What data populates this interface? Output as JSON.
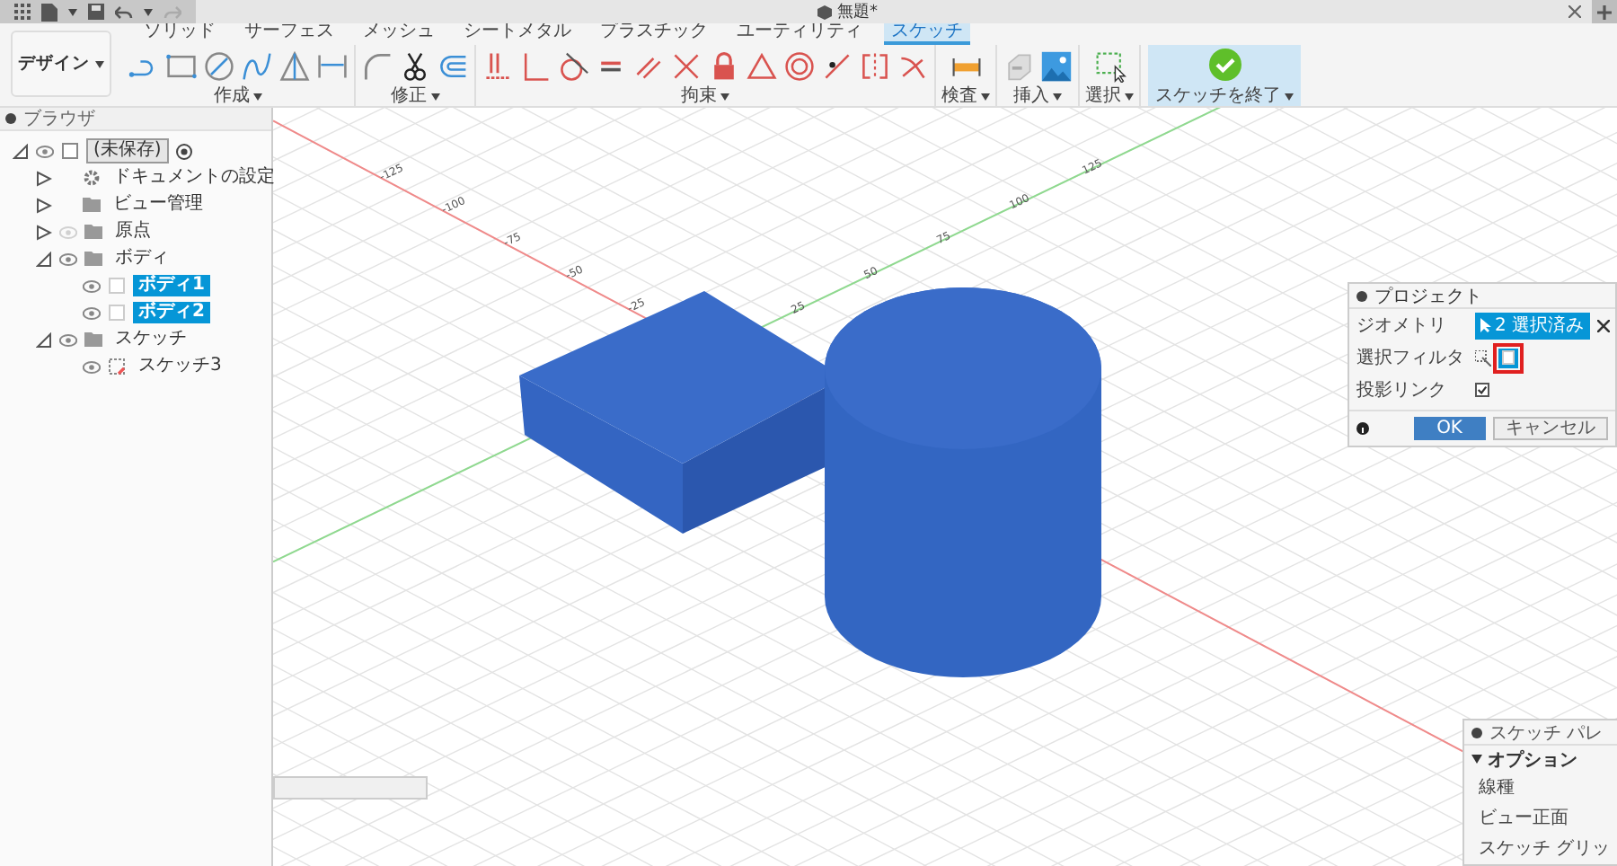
{
  "top_bar": {
    "title": "無題*",
    "redo": {
      "disabled": true
    }
  },
  "ribbon": {
    "workspace": "デザイン",
    "tabs": [
      {
        "label": "ソリッド",
        "selected": false
      },
      {
        "label": "サーフェス",
        "selected": false
      },
      {
        "label": "メッシュ",
        "selected": false
      },
      {
        "label": "シートメタル",
        "selected": false
      },
      {
        "label": "プラスチック",
        "selected": false
      },
      {
        "label": "ユーティリティ",
        "selected": false
      },
      {
        "label": "スケッチ",
        "selected": true
      }
    ],
    "groups": [
      {
        "label": "作成",
        "tools": [
          {
            "kind": "line"
          },
          {
            "kind": "rectangle"
          },
          {
            "kind": "circle"
          },
          {
            "kind": "spline"
          },
          {
            "kind": "mirror"
          },
          {
            "kind": "dimension"
          }
        ]
      },
      {
        "label": "修正",
        "tools": [
          {
            "kind": "fillet"
          },
          {
            "kind": "trim"
          },
          {
            "kind": "offset"
          }
        ]
      },
      {
        "label": "拘束",
        "tools": [
          {
            "kind": "fix"
          },
          {
            "kind": "perpendicular"
          },
          {
            "kind": "tangent"
          },
          {
            "kind": "equal"
          },
          {
            "kind": "parallel"
          },
          {
            "kind": "cross"
          },
          {
            "kind": "lock"
          },
          {
            "kind": "triangle"
          },
          {
            "kind": "concentric"
          },
          {
            "kind": "collinear"
          },
          {
            "kind": "symmetry"
          },
          {
            "kind": "curvature"
          }
        ]
      },
      {
        "label": "検査",
        "tools": [
          {
            "kind": "measure"
          }
        ]
      },
      {
        "label": "挿入",
        "tools": [
          {
            "kind": "insert"
          },
          {
            "kind": "image"
          }
        ]
      },
      {
        "label": "選択",
        "tools": [
          {
            "kind": "select"
          }
        ]
      }
    ],
    "finish": {
      "label": "スケッチを終了"
    }
  },
  "browser": {
    "title": "ブラウザ",
    "tree": [
      {
        "label": "(未保存)",
        "kind": "component",
        "expanded": true,
        "selected": false,
        "visible": true,
        "children": [
          {
            "label": "ドキュメントの設定",
            "kind": "settings",
            "expanded": false,
            "selected": false
          },
          {
            "label": "ビュー管理",
            "kind": "folder",
            "expanded": false,
            "selected": false
          },
          {
            "label": "原点",
            "kind": "folder",
            "expanded": false,
            "selected": false,
            "visible": false
          },
          {
            "label": "ボディ",
            "kind": "folder",
            "expanded": true,
            "selected": false,
            "visible": true,
            "children": [
              {
                "label": "ボディ1",
                "kind": "body",
                "selected": true,
                "visible": true
              },
              {
                "label": "ボディ2",
                "kind": "body",
                "selected": true,
                "visible": true
              }
            ]
          },
          {
            "label": "スケッチ",
            "kind": "folder",
            "expanded": true,
            "selected": false,
            "visible": true,
            "children": [
              {
                "label": "スケッチ3",
                "kind": "sketch",
                "selected": false,
                "visible": true
              }
            ]
          }
        ]
      }
    ]
  },
  "viewport": {
    "red_axis_labels": [
      "-25",
      "-50",
      "-75",
      "-100",
      "-125"
    ],
    "green_axis_labels": [
      "25",
      "50",
      "75",
      "100",
      "125"
    ]
  },
  "dialog": {
    "title": "プロジェクト",
    "rows": [
      {
        "kind": "selection",
        "label": "ジオメトリ",
        "value": "2 選択済み"
      },
      {
        "kind": "filter",
        "label": "選択フィルタ",
        "on": true,
        "highlighted": true
      },
      {
        "kind": "checkbox",
        "label": "投影リンク",
        "checked": true
      }
    ],
    "buttons": [
      {
        "label": "OK",
        "kind": "primary"
      },
      {
        "label": "キャンセル",
        "kind": "secondary"
      }
    ]
  },
  "palette": {
    "title": "スケッチ パレ",
    "section": "オプション",
    "expanded": true,
    "items": [
      "線種",
      "ビュー正面",
      "スケッチ グリッ"
    ]
  }
}
